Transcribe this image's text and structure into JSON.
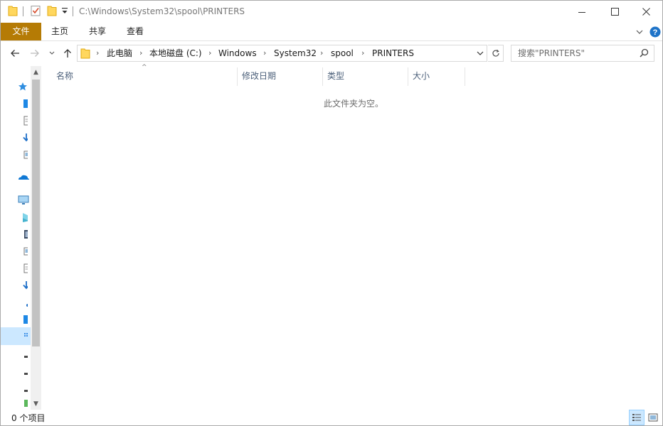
{
  "title_bar": {
    "path": "C:\\Windows\\System32\\spool\\PRINTERS",
    "quick_access": [
      "folder-icon",
      "properties-check-icon",
      "new-folder-icon",
      "customize-dropdown-icon"
    ],
    "buttons": [
      "minimize-icon",
      "maximize-icon",
      "close-icon"
    ]
  },
  "ribbon": {
    "tabs": [
      "文件",
      "主页",
      "共享",
      "查看"
    ],
    "file_tab_color": "#b57b05",
    "right": [
      "expand-ribbon-icon",
      "help-icon"
    ]
  },
  "address_bar": {
    "breadcrumbs": [
      "此电脑",
      "本地磁盘 (C:)",
      "Windows",
      "System32",
      "spool",
      "PRINTERS"
    ],
    "search_placeholder": "搜索\"PRINTERS\""
  },
  "nav_pane": {
    "icons": [
      "quick-access-star-icon",
      "desktop-icon",
      "documents-icon",
      "downloads-icon",
      "pictures-icon",
      "onedrive-icon",
      "this-pc-icon",
      "3d-objects-icon",
      "videos-icon",
      "pictures-icon",
      "documents-icon",
      "downloads-icon",
      "music-icon",
      "desktop-icon",
      "local-disk-icon",
      "drive-icon",
      "drive-icon",
      "drive-icon",
      "network-icon"
    ],
    "selected_color": "#cce8ff"
  },
  "columns": [
    "名称",
    "修改日期",
    "类型",
    "大小"
  ],
  "empty_message": "此文件夹为空。",
  "status": {
    "item_count": "0 个项目"
  }
}
